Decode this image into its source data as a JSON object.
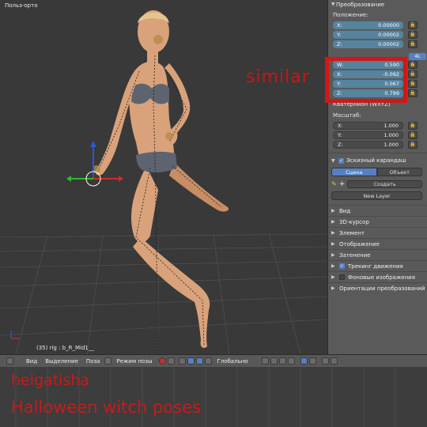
{
  "viewport": {
    "label": "Польз-орто",
    "status": "(35) rig : b_R_Mid1__",
    "overlay_text": "similar"
  },
  "panel": {
    "header": "Преобразование",
    "position_label": "Положение:",
    "position": [
      {
        "axis": "X:",
        "value": "0.00000"
      },
      {
        "axis": "Y:",
        "value": "0.00002"
      },
      {
        "axis": "Z:",
        "value": "0.00002"
      }
    ],
    "rotation_mode_button": "4L",
    "rotation": [
      {
        "axis": "W:",
        "value": "0.590"
      },
      {
        "axis": "X:",
        "value": "-0.092"
      },
      {
        "axis": "Y:",
        "value": "0.067"
      },
      {
        "axis": "Z:",
        "value": "0.799"
      }
    ],
    "rotation_mode_label": "Кватернион (WXYZ)",
    "scale_label": "Масштаб:",
    "scale": [
      {
        "axis": "X:",
        "value": "1.000"
      },
      {
        "axis": "Y:",
        "value": "1.000"
      },
      {
        "axis": "Z:",
        "value": "1.000"
      }
    ],
    "grease_pencil": {
      "title": "Эскизный карандаш",
      "tab_scene": "Сцена",
      "tab_object": "Объект",
      "create": "Создать",
      "new_layer": "New Layer"
    },
    "sections": [
      {
        "label": "Вид",
        "checkbox": null
      },
      {
        "label": "3D-курсор",
        "checkbox": null
      },
      {
        "label": "Элемент",
        "checkbox": null
      },
      {
        "label": "Отображение",
        "checkbox": null
      },
      {
        "label": "Затенение",
        "checkbox": null
      },
      {
        "label": "Трекинг движения",
        "checkbox": "on"
      },
      {
        "label": "Фоновые изображения",
        "checkbox": "off"
      },
      {
        "label": "Ориентации преобразований",
        "checkbox": null
      }
    ]
  },
  "toolbar": {
    "view": "Вид",
    "select": "Выделение",
    "pose": "Поза",
    "mode": "Режим позы",
    "pivot": "Глобально"
  },
  "credits": {
    "line1": "heigatisha",
    "line2": "Halloween witch poses"
  },
  "colors": {
    "highlight": "#d11717",
    "accent": "#5680c2",
    "field": "#56839e",
    "skin": "#d9a27a",
    "underwear": "#5d6470"
  }
}
